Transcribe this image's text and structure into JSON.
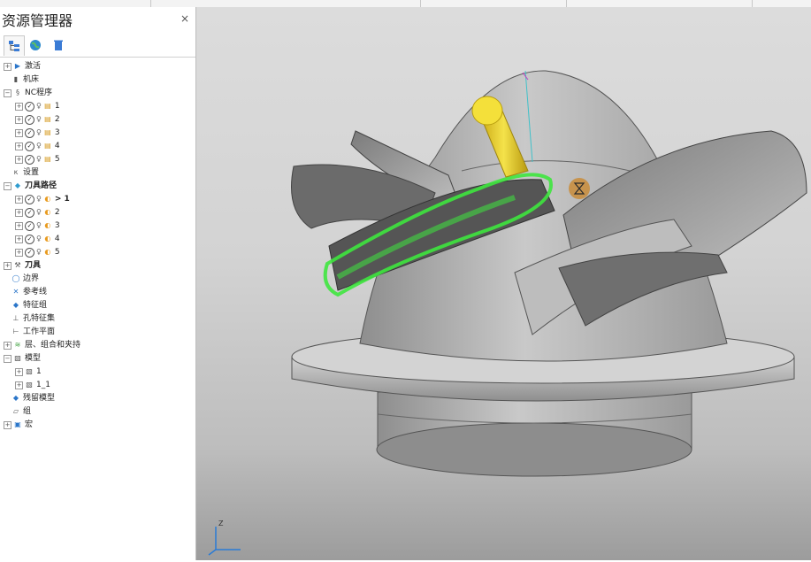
{
  "panel": {
    "title": "资源管理器",
    "close_glyph": "×"
  },
  "tabs": [
    {
      "icon": "tree-view-icon",
      "active": true
    },
    {
      "icon": "globe-icon",
      "active": false
    },
    {
      "icon": "trash-icon",
      "active": false
    }
  ],
  "tree": [
    {
      "label": "激活",
      "icon": "activate-icon",
      "expand": "+",
      "depth": 0,
      "bold": false
    },
    {
      "label": "机床",
      "icon": "machine-icon",
      "expand": "",
      "depth": 0,
      "bold": false
    },
    {
      "label": "NC程序",
      "icon": "nc-program-icon",
      "expand": "-",
      "depth": 0,
      "bold": false
    },
    {
      "label": "1",
      "icon": "nc-file-icon",
      "expand": "+",
      "depth": 1,
      "status": true
    },
    {
      "label": "2",
      "icon": "nc-file-icon",
      "expand": "+",
      "depth": 1,
      "status": true
    },
    {
      "label": "3",
      "icon": "nc-file-icon",
      "expand": "+",
      "depth": 1,
      "status": true
    },
    {
      "label": "4",
      "icon": "nc-file-icon",
      "expand": "+",
      "depth": 1,
      "status": true
    },
    {
      "label": "5",
      "icon": "nc-file-icon",
      "expand": "+",
      "depth": 1,
      "status": true
    },
    {
      "label": "设置",
      "icon": "setup-icon",
      "expand": "",
      "depth": 0,
      "bold": false
    },
    {
      "label": "刀具路径",
      "icon": "toolpath-icon",
      "expand": "-",
      "depth": 0,
      "bold": true
    },
    {
      "label": "> 1",
      "icon": "toolpath-item-icon",
      "expand": "+",
      "depth": 1,
      "status": true,
      "bold": true
    },
    {
      "label": "2",
      "icon": "toolpath-item-icon",
      "expand": "+",
      "depth": 1,
      "status": true
    },
    {
      "label": "3",
      "icon": "toolpath-item-icon",
      "expand": "+",
      "depth": 1,
      "status": true
    },
    {
      "label": "4",
      "icon": "toolpath-item-icon",
      "expand": "+",
      "depth": 1,
      "status": true
    },
    {
      "label": "5",
      "icon": "toolpath-item-icon",
      "expand": "+",
      "depth": 1,
      "status": true
    },
    {
      "label": "刀具",
      "icon": "tool-icon",
      "expand": "+",
      "depth": 0,
      "bold": true
    },
    {
      "label": "边界",
      "icon": "boundary-icon",
      "expand": "",
      "depth": 0,
      "bold": false
    },
    {
      "label": "参考线",
      "icon": "pattern-icon",
      "expand": "",
      "depth": 0,
      "bold": false
    },
    {
      "label": "特征组",
      "icon": "feature-set-icon",
      "expand": "",
      "depth": 0,
      "bold": false
    },
    {
      "label": "孔特征集",
      "icon": "hole-feature-icon",
      "expand": "",
      "depth": 0,
      "bold": false
    },
    {
      "label": "工作平面",
      "icon": "workplane-icon",
      "expand": "",
      "depth": 0,
      "bold": false
    },
    {
      "label": "层、组合和夹持",
      "icon": "layers-icon",
      "expand": "+",
      "depth": 0,
      "bold": false
    },
    {
      "label": "模型",
      "icon": "model-icon",
      "expand": "-",
      "depth": 0,
      "bold": false
    },
    {
      "label": "1",
      "icon": "model-item-icon",
      "expand": "+",
      "depth": 1
    },
    {
      "label": "1_1",
      "icon": "model-item-icon",
      "expand": "+",
      "depth": 1
    },
    {
      "label": "残留模型",
      "icon": "stock-model-icon",
      "expand": "",
      "depth": 0,
      "bold": false
    },
    {
      "label": "组",
      "icon": "group-icon",
      "expand": "",
      "depth": 0,
      "bold": false
    },
    {
      "label": "宏",
      "icon": "macro-icon",
      "expand": "+",
      "depth": 0,
      "bold": false
    }
  ],
  "viewport": {
    "axis_label": "Z",
    "colors": {
      "part": "#a8a8a8",
      "toolpath": "#3ee63e",
      "tool": "#e8d21b",
      "busy": "#c98c3a"
    }
  }
}
